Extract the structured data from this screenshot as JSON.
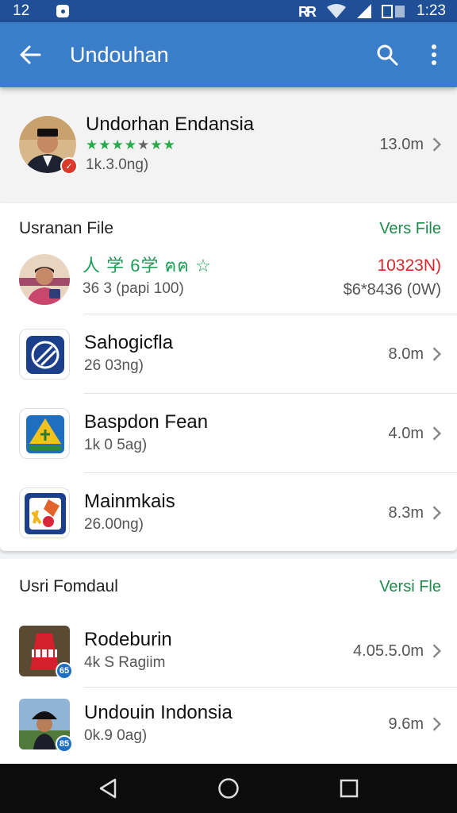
{
  "status_bar": {
    "time_left": "12",
    "time_right": "1:23"
  },
  "app_bar": {
    "title": "Undouhan"
  },
  "featured": {
    "title": "Undorhan Endansia",
    "sub": "1k.3.0ng)",
    "size": "13.0m",
    "rating_stars": 7
  },
  "section1": {
    "title": "Usranan File",
    "link": "Vers File",
    "items": [
      {
        "title": "人 学 6学 ฅฅ ☆",
        "sub": "36 3 (papi 100)",
        "price_red": "10323N)",
        "price_gray": "$6*8436 (0W)"
      },
      {
        "title": "Sahogicfla",
        "sub": "26 03ng)",
        "size": "8.0m"
      },
      {
        "title": "Baspdon Fean",
        "sub": "1k 0 5ag)",
        "size": "4.0m"
      },
      {
        "title": "Mainmkais",
        "sub": "26.00ng)",
        "size": "8.3m"
      }
    ]
  },
  "section2": {
    "title": "Usri Fomdaul",
    "link": "Versi Fle",
    "items": [
      {
        "title": "Rodeburin",
        "sub": "4k S Ragiim",
        "size": "4.05.5.0m",
        "badge": "65"
      },
      {
        "title": "Undouin Indonsia",
        "sub": "0k.9 0ag)",
        "size": "9.6m",
        "badge": "85"
      }
    ]
  },
  "colors": {
    "app_bar": "#3a7dc9",
    "status_bar": "#1f4f96",
    "accent_green": "#1e8a4a",
    "price_red": "#d8262a"
  },
  "icons": [
    "back-arrow-icon",
    "search-icon",
    "more-vert-icon",
    "chevron-right-icon",
    "nav-back-icon",
    "nav-home-icon",
    "nav-recents-icon"
  ]
}
